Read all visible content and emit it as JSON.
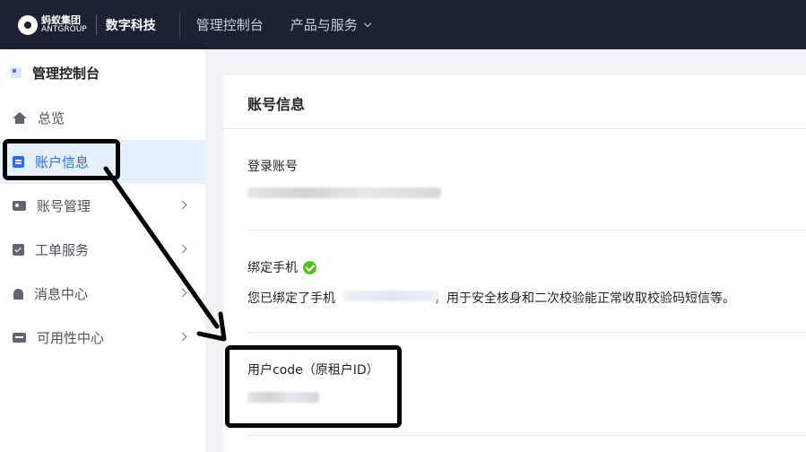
{
  "header": {
    "logo_cn": "蚂蚁集团",
    "logo_en": "ANTGROUP",
    "brand": "数字科技",
    "nav": [
      "管理控制台",
      "产品与服务"
    ]
  },
  "sidebar": {
    "title": "管理控制台",
    "items": [
      {
        "label": "总览",
        "icon": "home-icon"
      },
      {
        "label": "账户信息",
        "icon": "document-icon"
      },
      {
        "label": "账号管理",
        "icon": "id-card-icon"
      },
      {
        "label": "工单服务",
        "icon": "checklist-icon"
      },
      {
        "label": "消息中心",
        "icon": "bell-icon"
      },
      {
        "label": "可用性中心",
        "icon": "monitor-icon"
      }
    ]
  },
  "main": {
    "title": "账号信息",
    "login_label": "登录账号",
    "phone_label": "绑定手机",
    "phone_desc_prefix": "您已绑定了手机",
    "phone_desc_suffix": "，用于安全核身和二次校验能正常收取校验码短信等。",
    "code_label": "用户code（原租户ID）"
  },
  "colors": {
    "topbar": "#1c2233",
    "accent": "#2f6bf2",
    "active_bg": "#e6f0ff",
    "success": "#52c41a"
  }
}
